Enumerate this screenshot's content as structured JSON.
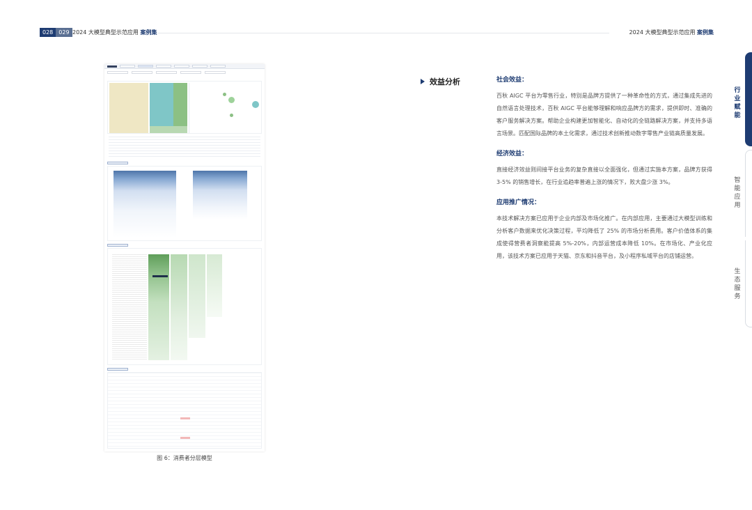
{
  "header": {
    "page_left": "028",
    "page_right": "029",
    "title_left_prefix": "2024 大模型典型示范应用",
    "title_left_emph": "案例集",
    "title_right_prefix": "2024 大模型典型示范应用",
    "title_right_emph": "案例集"
  },
  "side_tabs": [
    "行业赋能",
    "智能应用",
    "生态服务"
  ],
  "section_label": "效益分析",
  "content": {
    "social_heading": "社会效益：",
    "social_text": "百秋 AIGC 平台为零售行业，特别是品牌方提供了一种革命性的方式，通过集成先进的自然语言处理技术，百秋 AIGC 平台能够理解和响应品牌方的需求，提供即时、准确的客户服务解决方案。帮助企业构建更加智能化、自动化的全链路解决方案，并支持多语言场景。匹配国际品牌的本土化需求，通过技术创新推动数字零售产业链高质量发展。",
    "economic_heading": "经济效益：",
    "economic_text": "直接经济效益则间接平台业务的复杂直接以全面强化，但通过实施本方案，品牌方获得 3-5% 的销售增长，在行业追趋率普遍上涨的情况下，败大盘少涨 3%。",
    "promotion_heading": "应用推广情况：",
    "promotion_text": "本技术解决方案已应用于企业内部及市场化推广。在内部应用，主要通过大模型训练和分析客户数据来优化决策过程，平均降低了 25% 的市场分析费用。客户价值体系的集成使得营费者洞察能提高 5%-20%，内部运营成本降低 10%。在市场化、产业化应用，该技术方案已应用于天猫、京东和抖音平台，及小程序私域平台的店铺运营。"
  },
  "figure_caption": "图 6：消费者分层模型",
  "colors": {
    "brand_navy": "#1e3c72",
    "treemap_beige": "#efe7c4",
    "treemap_teal": "#7fc6c7",
    "treemap_green": "#8cc084"
  }
}
